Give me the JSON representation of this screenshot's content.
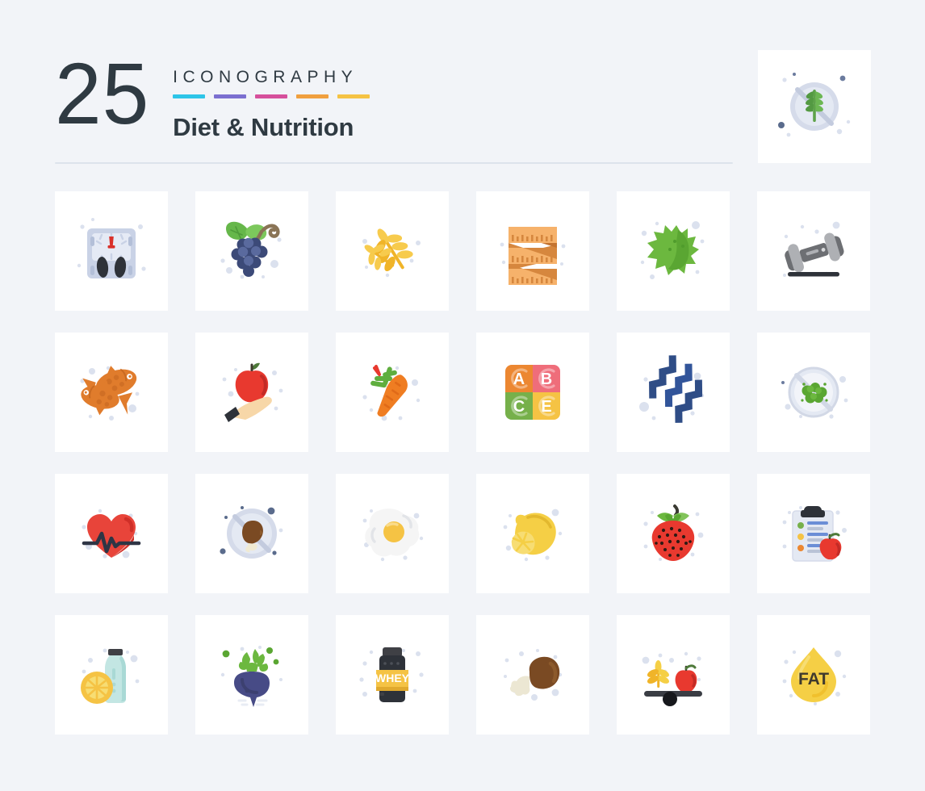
{
  "header": {
    "count": "25",
    "kicker": "ICONOGRAPHY",
    "title": "Diet & Nutrition",
    "bar_colors": [
      "#29c0e8",
      "#7a6fce",
      "#d84f9b",
      "#f0a347",
      "#f5c councils"
    ]
  },
  "palette": {
    "background": "#f2f4f8",
    "tile": "#ffffff",
    "text_dark": "#2f3a42",
    "divider": "#dde3ec",
    "dot_light": "#dbe1ee",
    "dot_dark": "#5a6b8c"
  },
  "bars": [
    {
      "name": "bar-cyan",
      "color": "#2ec5e8"
    },
    {
      "name": "bar-purple",
      "color": "#7b6fd0"
    },
    {
      "name": "bar-pink",
      "color": "#d6509c"
    },
    {
      "name": "bar-orange",
      "color": "#f0a03f"
    },
    {
      "name": "bar-yellow",
      "color": "#f5c344"
    }
  ],
  "featured": {
    "icon": "gluten-free-icon",
    "label": "Gluten Free"
  },
  "grid": {
    "columns": 6,
    "rows": 4,
    "icons": [
      {
        "icon": "weight-scale-icon",
        "label": "Weight Scale"
      },
      {
        "icon": "grapes-icon",
        "label": "Grapes"
      },
      {
        "icon": "wheat-icon",
        "label": "Wheat"
      },
      {
        "icon": "measuring-tape-icon",
        "label": "Measuring Tape"
      },
      {
        "icon": "lettuce-icon",
        "label": "Lettuce"
      },
      {
        "icon": "dumbbell-icon",
        "label": "Dumbbell"
      },
      {
        "icon": "fish-icon",
        "label": "Fish"
      },
      {
        "icon": "apple-in-hand-icon",
        "label": "Apple In Hand"
      },
      {
        "icon": "carrot-icon",
        "label": "Carrot"
      },
      {
        "icon": "vitamins-icon",
        "label": "Vitamins"
      },
      {
        "icon": "protein-helix-icon",
        "label": "Protein"
      },
      {
        "icon": "no-vegetables-icon",
        "label": "No Vegetables"
      },
      {
        "icon": "heartbeat-icon",
        "label": "Heartbeat"
      },
      {
        "icon": "no-meat-icon",
        "label": "No Meat"
      },
      {
        "icon": "fried-egg-icon",
        "label": "Fried Egg"
      },
      {
        "icon": "lemon-icon",
        "label": "Lemon"
      },
      {
        "icon": "strawberry-icon",
        "label": "Strawberry"
      },
      {
        "icon": "diet-plan-icon",
        "label": "Diet Plan"
      },
      {
        "icon": "lemon-water-icon",
        "label": "Lemon Water"
      },
      {
        "icon": "beetroot-icon",
        "label": "Beetroot"
      },
      {
        "icon": "whey-protein-icon",
        "label": "Whey Protein"
      },
      {
        "icon": "drumstick-icon",
        "label": "Drumstick"
      },
      {
        "icon": "balanced-diet-icon",
        "label": "Balanced Diet"
      },
      {
        "icon": "fat-drop-icon",
        "label": "Fat"
      }
    ]
  },
  "icon_text": {
    "vitamin_a": "A",
    "vitamin_b": "B",
    "vitamin_c": "C",
    "vitamin_e": "E",
    "whey_label": "WHEY",
    "fat_label": "FAT"
  }
}
